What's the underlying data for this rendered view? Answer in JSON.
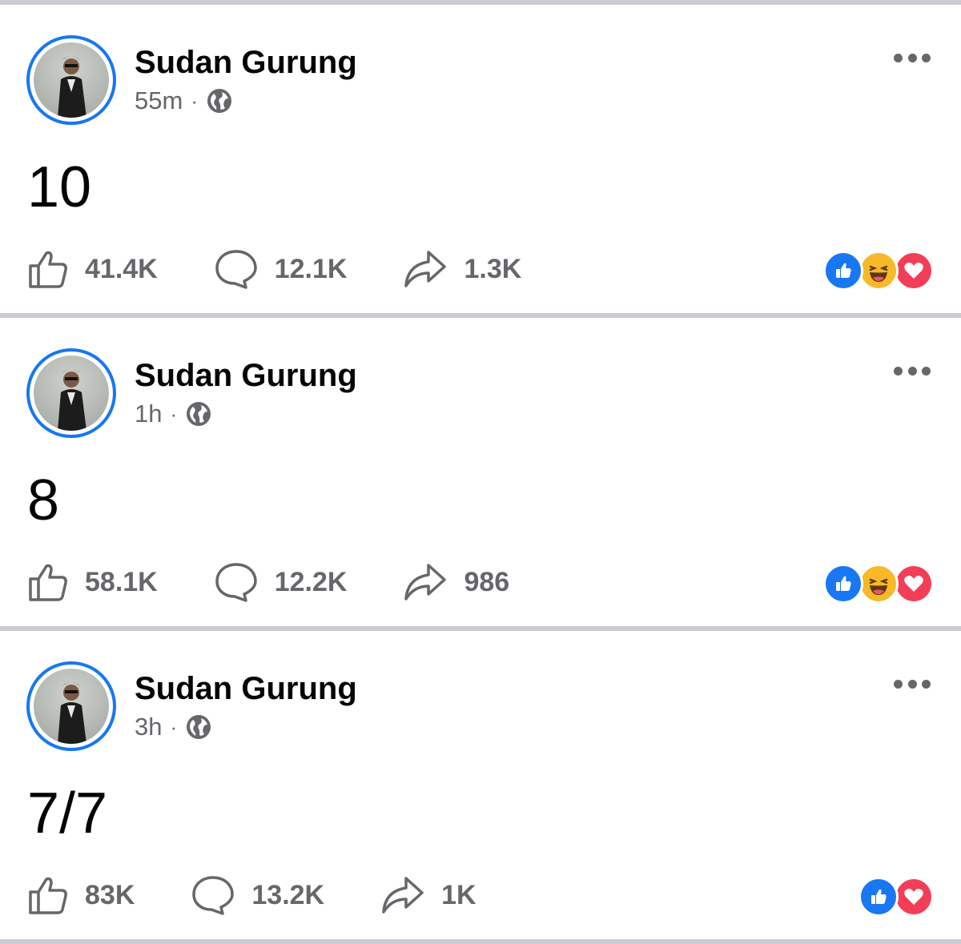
{
  "colors": {
    "accent": "#1877f2",
    "muted_text": "#65676b",
    "divider": "#c9ccd1",
    "love": "#f33e58",
    "haha": "#f7b928"
  },
  "posts": [
    {
      "author": "Sudan Gurung",
      "time": "55m",
      "separator": "·",
      "privacy_icon": "globe-icon",
      "text": "10",
      "likes": "41.4K",
      "comments": "12.1K",
      "shares": "1.3K",
      "reactions": [
        "like",
        "haha",
        "love"
      ]
    },
    {
      "author": "Sudan Gurung",
      "time": "1h",
      "separator": "·",
      "privacy_icon": "globe-icon",
      "text": "8",
      "likes": "58.1K",
      "comments": "12.2K",
      "shares": "986",
      "reactions": [
        "like",
        "haha",
        "love"
      ]
    },
    {
      "author": "Sudan Gurung",
      "time": "3h",
      "separator": "·",
      "privacy_icon": "globe-icon",
      "text": "7/7",
      "likes": "83K",
      "comments": "13.2K",
      "shares": "1K",
      "reactions": [
        "like",
        "love"
      ]
    }
  ]
}
